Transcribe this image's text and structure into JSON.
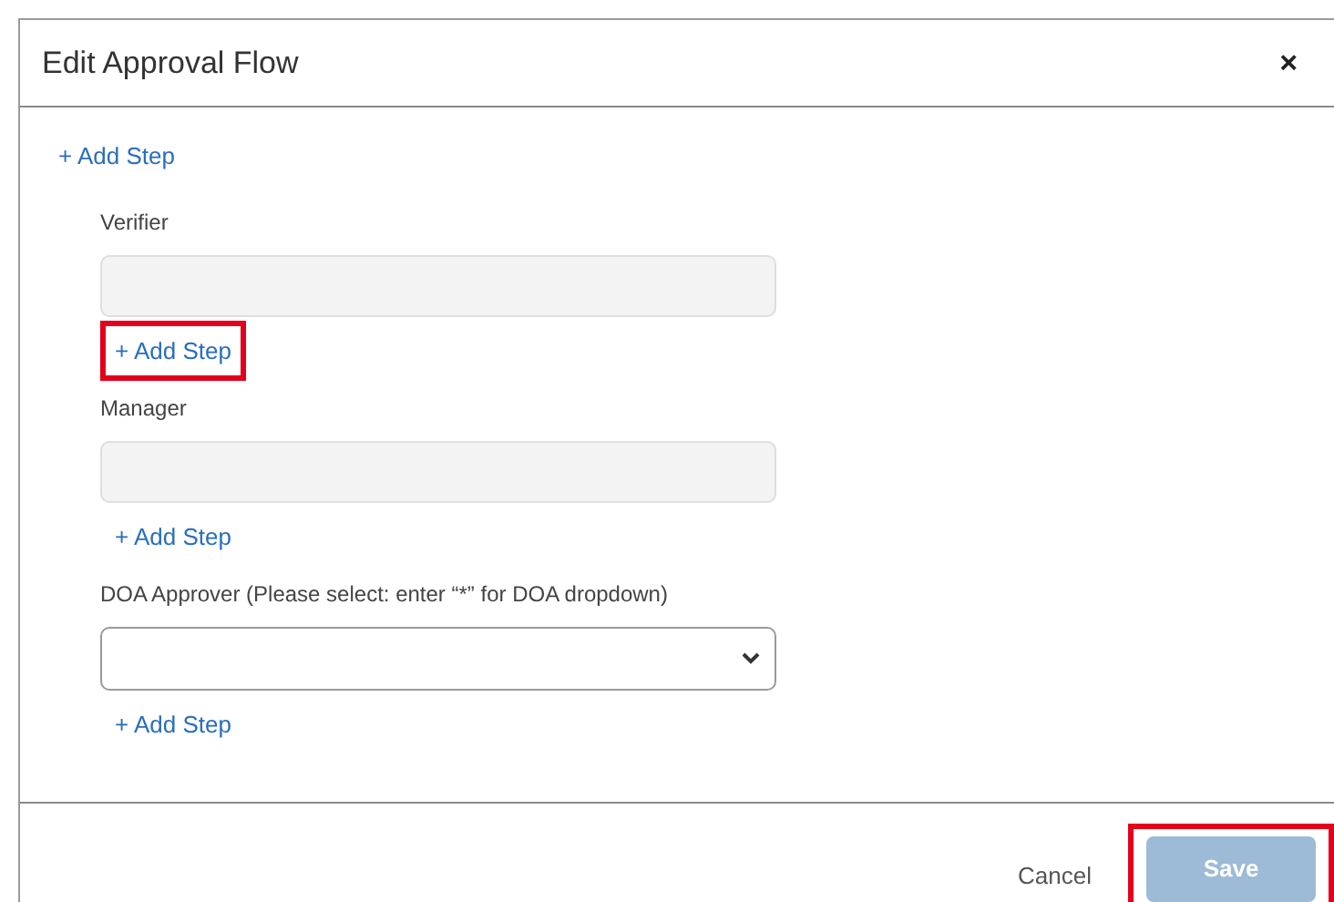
{
  "dialog": {
    "title": "Edit Approval Flow",
    "close": "×"
  },
  "top_add_step": {
    "label": "+ Add Step",
    "highlighted": false
  },
  "steps": [
    {
      "kind": "text",
      "label": "Verifier",
      "add_step": {
        "label": "+ Add Step",
        "highlighted": true
      }
    },
    {
      "kind": "text",
      "label": "Manager",
      "add_step": {
        "label": "+ Add Step",
        "highlighted": false
      }
    },
    {
      "kind": "select",
      "label": "DOA Approver (Please select: enter “*” for DOA dropdown)",
      "add_step": {
        "label": "+ Add Step",
        "highlighted": false
      }
    }
  ],
  "footer": {
    "cancel": "Cancel",
    "save": {
      "label": "Save",
      "disabled": true,
      "highlighted": true
    }
  }
}
